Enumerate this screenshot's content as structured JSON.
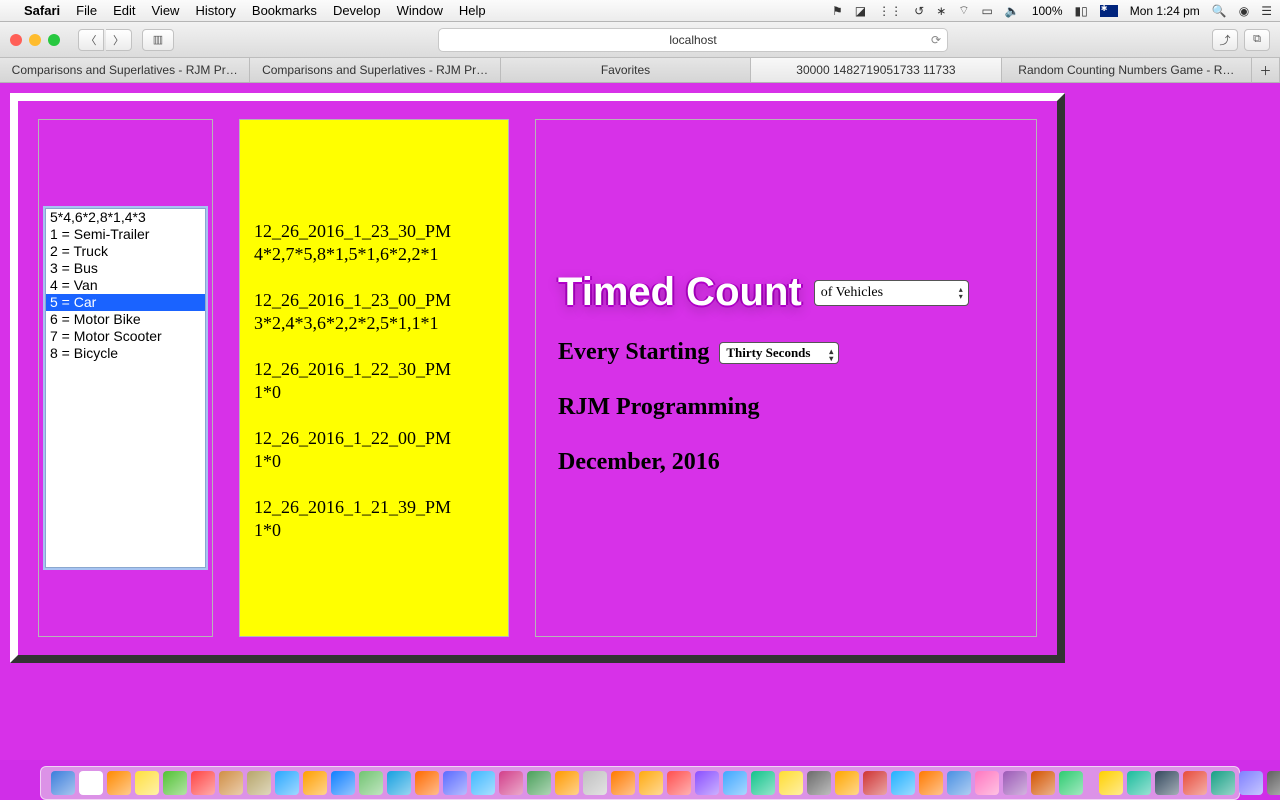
{
  "menubar": {
    "app": "Safari",
    "items": [
      "File",
      "Edit",
      "View",
      "History",
      "Bookmarks",
      "Develop",
      "Window",
      "Help"
    ],
    "battery": "100%",
    "clock": "Mon 1:24 pm"
  },
  "toolbar": {
    "address": "localhost"
  },
  "tabs": [
    {
      "label": "Comparisons and Superlatives - RJM Pr…",
      "active": false
    },
    {
      "label": "Comparisons and Superlatives - RJM Pr…",
      "active": false
    },
    {
      "label": "Favorites",
      "active": false
    },
    {
      "label": "30000 1482719051733 11733",
      "active": true
    },
    {
      "label": "Random Counting Numbers Game - R…",
      "active": false
    }
  ],
  "listbox": {
    "options": [
      "5*4,6*2,8*1,4*3",
      "1 = Semi-Trailer",
      "2 = Truck",
      "3 = Bus",
      "4 = Van",
      "5 = Car",
      "6 = Motor Bike",
      "7 = Motor Scooter",
      "8 = Bicycle"
    ],
    "selectedIndex": 5
  },
  "log": [
    {
      "ts": "12_26_2016_1_23_30_PM",
      "data": "4*2,7*5,8*1,5*1,6*2,2*1"
    },
    {
      "ts": "12_26_2016_1_23_00_PM",
      "data": "3*2,4*3,6*2,2*2,5*1,1*1"
    },
    {
      "ts": "12_26_2016_1_22_30_PM",
      "data": "1*0"
    },
    {
      "ts": "12_26_2016_1_22_00_PM",
      "data": "1*0"
    },
    {
      "ts": "12_26_2016_1_21_39_PM",
      "data": "1*0"
    }
  ],
  "right": {
    "title": "Timed Count",
    "select1": "of Vehicles",
    "line2_label": "Every Starting",
    "select2": "Thirty Seconds",
    "line3": "RJM Programming",
    "line4": "December, 2016"
  },
  "dock_colors": [
    "#3b7edb",
    "#ffffff",
    "#ff8a00",
    "#ffdf3f",
    "#52c234",
    "#ff4444",
    "#d08f46",
    "#b7a66b",
    "#2aa8ff",
    "#ff9f00",
    "#0f7fff",
    "#72c472",
    "#16a0e0",
    "#ff6a00",
    "#5b6bff",
    "#3fb8ff",
    "#d23f8a",
    "#4aa05a",
    "#ff9a00",
    "#c0c0c0",
    "#ff7a00",
    "#ffaa11",
    "#ff4f4f",
    "#8a4fff",
    "#3fa7ff",
    "#11c48b",
    "#ffdd33",
    "#6b6b6b",
    "#ffa600",
    "#cf3434",
    "#21b0ff",
    "#ff7a00",
    "#4a90e2",
    "#ff77c0",
    "#9b59b6",
    "#d35400",
    "#2ecc71",
    "#ffd000",
    "#1abc9c",
    "#34495e",
    "#e74c3c",
    "#16a085",
    "#8080ff",
    "#606060"
  ]
}
